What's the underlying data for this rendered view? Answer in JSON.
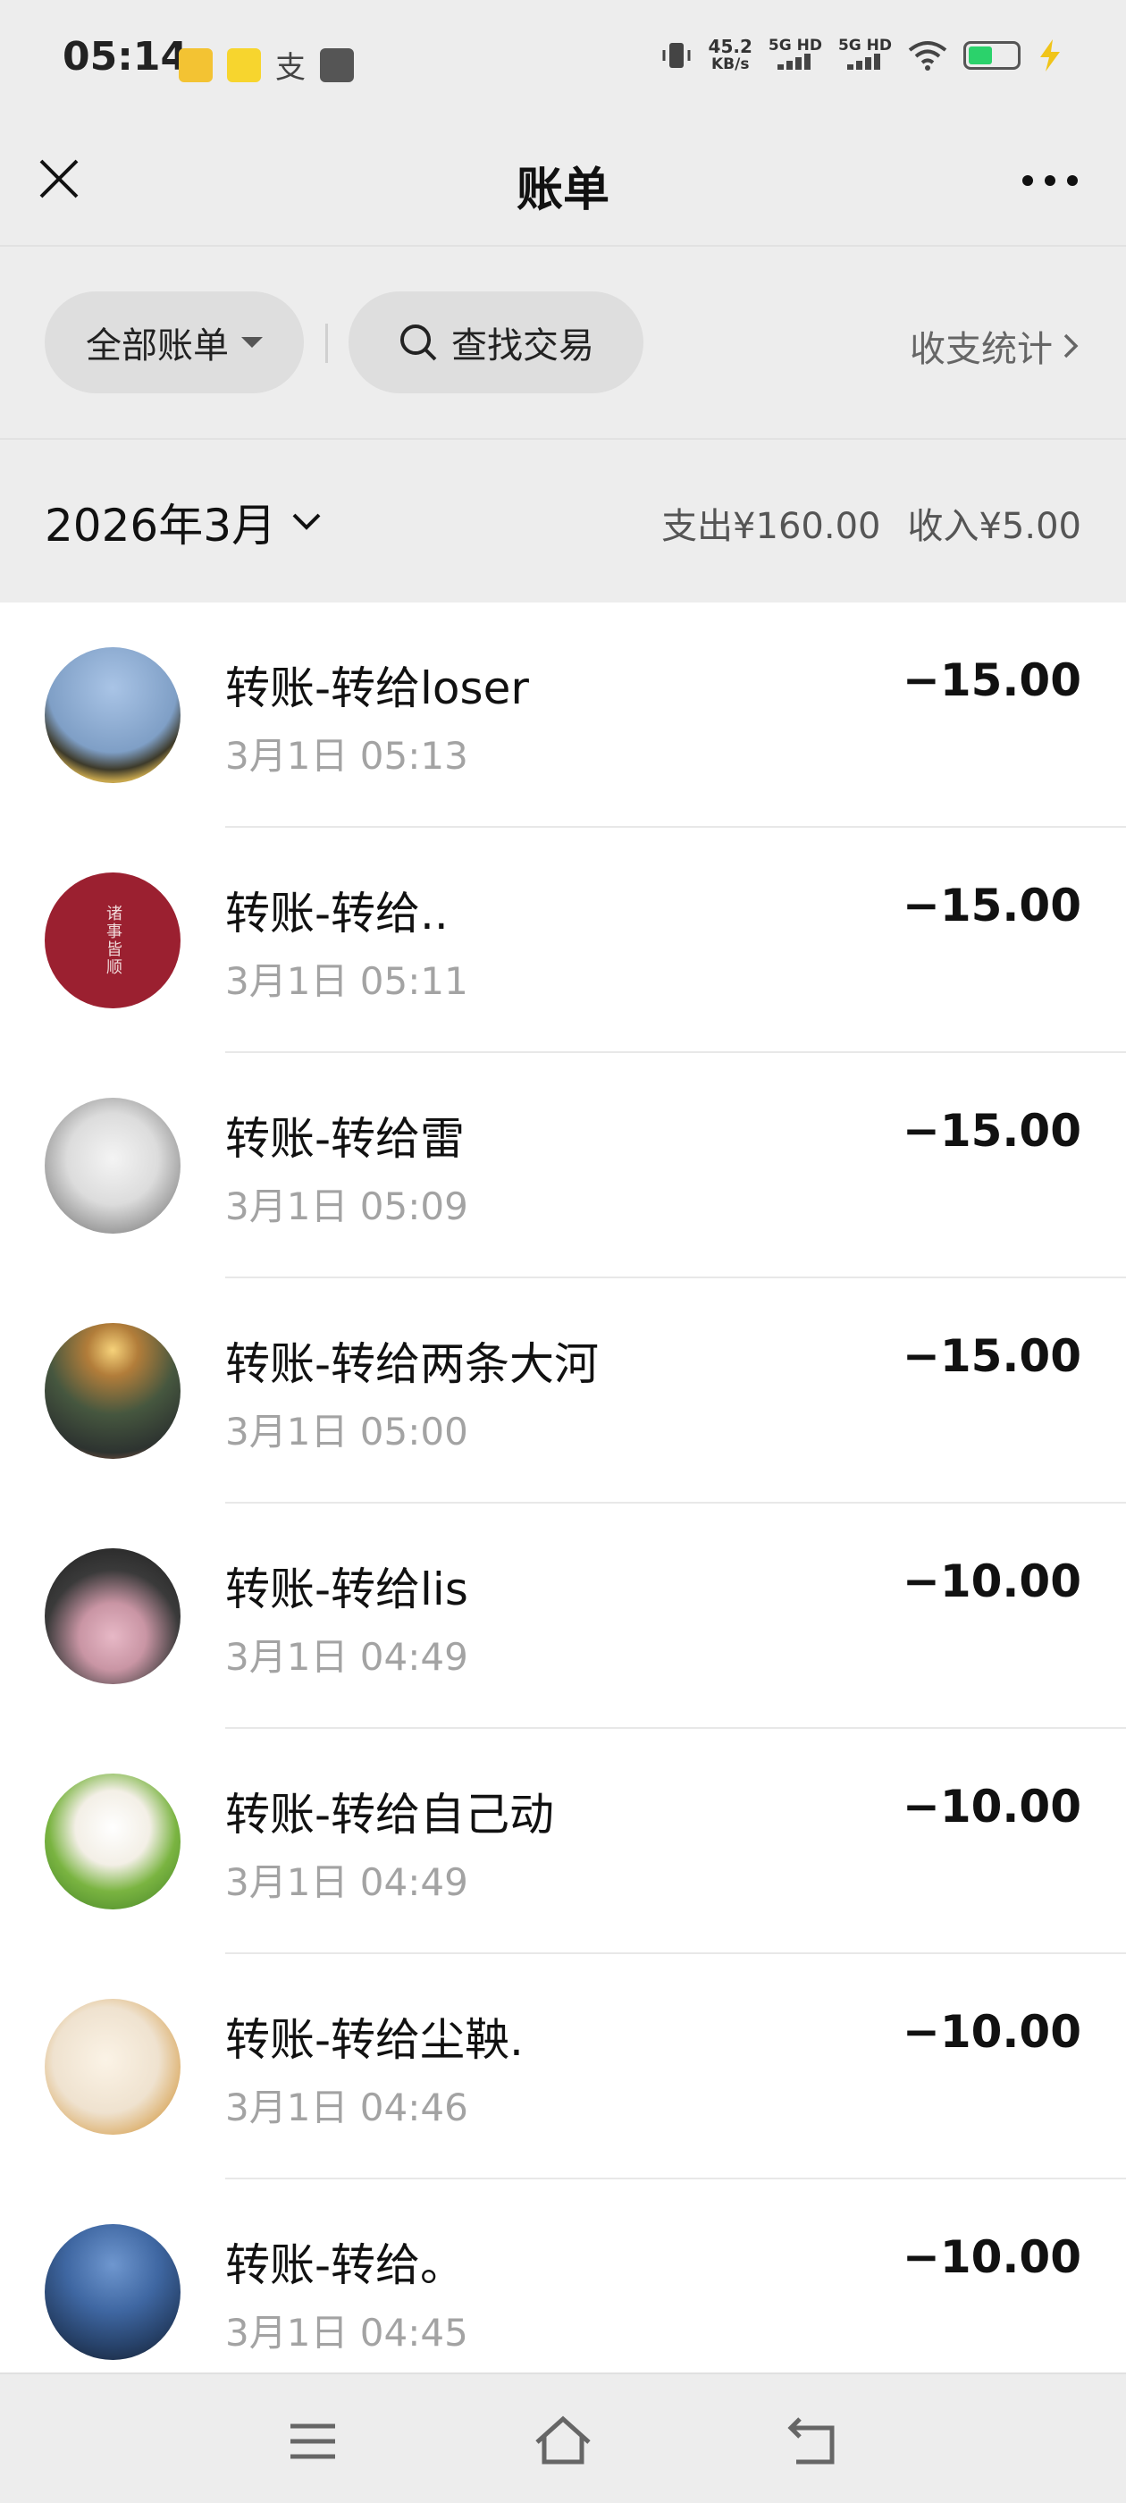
{
  "status_bar": {
    "time": "05:14",
    "net_speed_value": "45.2",
    "net_speed_unit": "KB/s",
    "signal1": "5G HD",
    "signal2": "5G HD"
  },
  "header": {
    "title": "账单"
  },
  "filter": {
    "all_bills_label": "全部账单",
    "search_label": "查找交易",
    "stats_label": "收支统计"
  },
  "month": {
    "label": "2026年3月",
    "expense": "支出¥160.00",
    "income": "收入¥5.00"
  },
  "transactions": [
    {
      "title": "转账-转给loser",
      "time": "3月1日 05:13",
      "amount": "−15.00"
    },
    {
      "title": "转账-转给..",
      "time": "3月1日 05:11",
      "amount": "−15.00"
    },
    {
      "title": "转账-转给雷",
      "time": "3月1日 05:09",
      "amount": "−15.00"
    },
    {
      "title": "转账-转给两条大河",
      "time": "3月1日 05:00",
      "amount": "−15.00"
    },
    {
      "title": "转账-转给lis",
      "time": "3月1日 04:49",
      "amount": "−10.00"
    },
    {
      "title": "转账-转给自己动",
      "time": "3月1日 04:49",
      "amount": "−10.00"
    },
    {
      "title": "转账-转给尘鞅.",
      "time": "3月1日 04:46",
      "amount": "−10.00"
    },
    {
      "title": "转账-转给。",
      "time": "3月1日 04:45",
      "amount": "−10.00"
    }
  ],
  "avatar_colors": [
    "#7f9fc6",
    "#9b2030",
    "#cfcfcf",
    "#46573f",
    "#3a3a3a",
    "#7ab441",
    "#efe2cf",
    "#27426a"
  ],
  "avatar_seal_text": "诸事皆顺"
}
